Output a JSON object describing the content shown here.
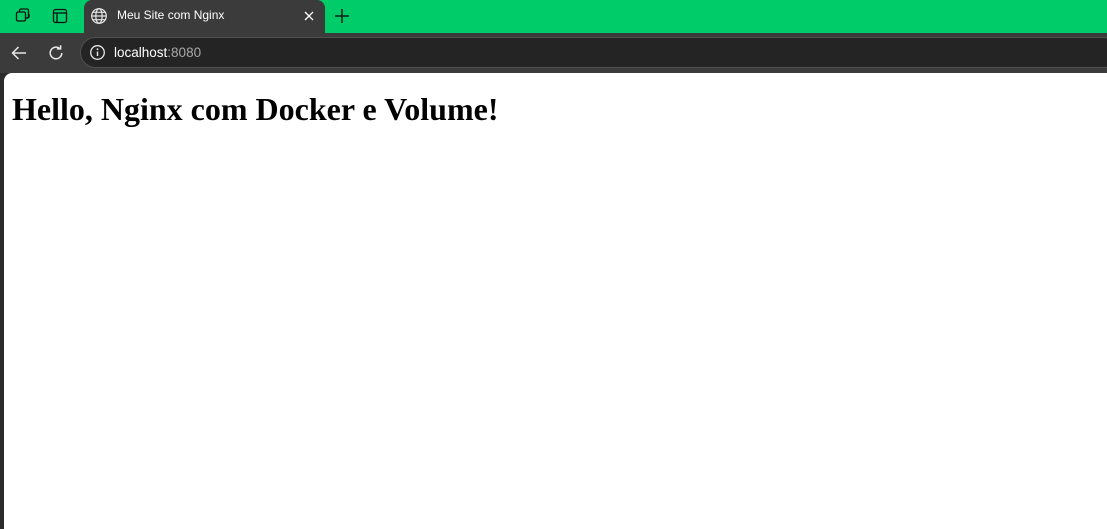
{
  "browser": {
    "tab": {
      "title": "Meu Site com Nginx",
      "favicon": "globe-icon"
    },
    "address_bar": {
      "host": "localhost",
      "port": ":8080",
      "security_icon": "info-icon"
    },
    "colors": {
      "tabstrip": "#00cc6a",
      "toolbar": "#3b3b3b",
      "address_field": "#242424"
    }
  },
  "page": {
    "heading": "Hello, Nginx com Docker e Volume!"
  }
}
